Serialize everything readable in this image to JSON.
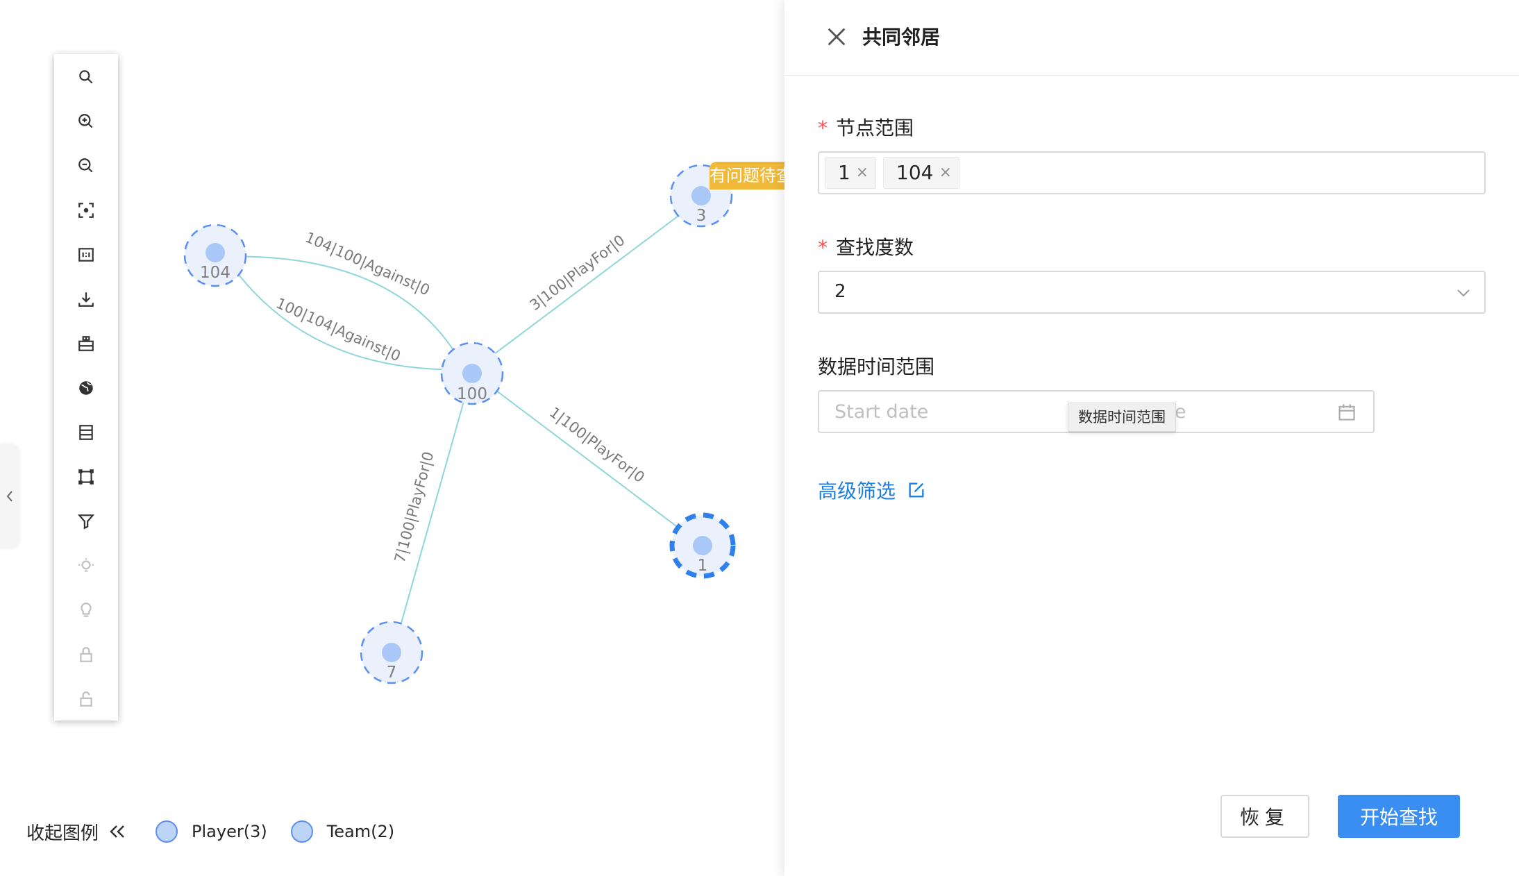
{
  "graph": {
    "nodes": [
      {
        "id": "104",
        "label": "104",
        "highlight": false
      },
      {
        "id": "100",
        "label": "100",
        "highlight": false
      },
      {
        "id": "3",
        "label": "3",
        "highlight": false
      },
      {
        "id": "1",
        "label": "1",
        "highlight": true
      },
      {
        "id": "7",
        "label": "7",
        "highlight": false
      }
    ],
    "edges": [
      {
        "label": "104|100|Against|0"
      },
      {
        "label": "100|104|Against|0"
      },
      {
        "label": "3|100|PlayFor|0"
      },
      {
        "label": "1|100|PlayFor|0"
      },
      {
        "label": "7|100|PlayFor|0"
      }
    ],
    "pending_badge": "有问题待查",
    "colors": {
      "node_fill": "#a9c7f7",
      "node_halo": "#eaf1fd",
      "node_ring": "#5b8ff0",
      "edge": "#8fd6d9"
    }
  },
  "toolbar": {
    "tools": [
      {
        "icon": "search-icon"
      },
      {
        "icon": "zoom-in-icon"
      },
      {
        "icon": "zoom-out-icon"
      },
      {
        "icon": "fit-view-icon"
      },
      {
        "icon": "actual-size-icon"
      },
      {
        "icon": "download-icon"
      },
      {
        "icon": "layout-icon"
      },
      {
        "icon": "globe-icon"
      },
      {
        "icon": "list-icon"
      },
      {
        "icon": "select-box-icon"
      },
      {
        "icon": "filter-icon"
      },
      {
        "icon": "highlight-bulb-icon"
      },
      {
        "icon": "bulb-icon"
      },
      {
        "icon": "lock-icon"
      },
      {
        "icon": "unlock-icon"
      }
    ]
  },
  "legend": {
    "toggle_label": "收起图例",
    "items": [
      {
        "label": "Player(3)"
      },
      {
        "label": "Team(2)"
      }
    ]
  },
  "drawer": {
    "title": "共同邻居",
    "node_range": {
      "label": "节点范围",
      "tags": [
        "1",
        "104"
      ],
      "remove_glyph": "×"
    },
    "degree": {
      "label": "查找度数",
      "value": "2"
    },
    "time_range": {
      "label": "数据时间范围",
      "start_placeholder": "Start date",
      "end_fragment": "e",
      "tooltip": "数据时间范围"
    },
    "advanced_filter": "高级筛选",
    "reset_button": "恢复",
    "search_button": "开始查找",
    "accent_color": "#3a8ef2"
  }
}
